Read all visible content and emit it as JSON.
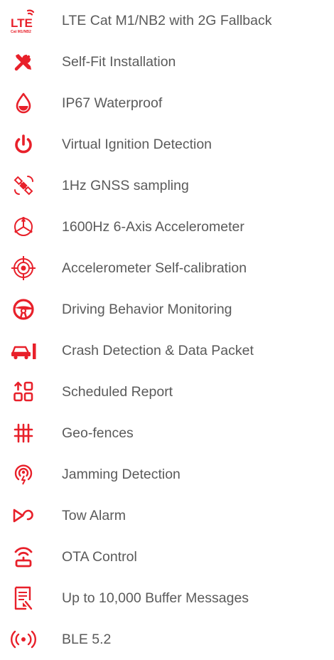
{
  "theme": {
    "accent": "#e8202a",
    "text": "#5a5a5a"
  },
  "lte_badge": {
    "main": "LTE",
    "sub": "Cat M1/NB2"
  },
  "features": [
    {
      "icon": "lte-icon",
      "label": "LTE Cat M1/NB2 with 2G Fallback"
    },
    {
      "icon": "tools-icon",
      "label": "Self-Fit Installation"
    },
    {
      "icon": "water-drop-icon",
      "label": "IP67 Waterproof"
    },
    {
      "icon": "power-icon",
      "label": "Virtual Ignition Detection"
    },
    {
      "icon": "satellite-icon",
      "label": "1Hz GNSS sampling"
    },
    {
      "icon": "accelerometer-axis-icon",
      "label": "1600Hz 6-Axis Accelerometer"
    },
    {
      "icon": "crosshair-icon",
      "label": "Accelerometer Self-calibration"
    },
    {
      "icon": "steering-wheel-icon",
      "label": "Driving Behavior Monitoring"
    },
    {
      "icon": "car-crash-icon",
      "label": "Crash Detection & Data Packet"
    },
    {
      "icon": "scheduled-report-icon",
      "label": "Scheduled Report"
    },
    {
      "icon": "geo-fence-icon",
      "label": "Geo-fences"
    },
    {
      "icon": "jamming-icon",
      "label": "Jamming Detection"
    },
    {
      "icon": "tow-icon",
      "label": "Tow Alarm"
    },
    {
      "icon": "ota-icon",
      "label": "OTA Control"
    },
    {
      "icon": "buffer-document-icon",
      "label": "Up to 10,000 Buffer Messages"
    },
    {
      "icon": "ble-signal-icon",
      "label": "BLE 5.2"
    }
  ]
}
